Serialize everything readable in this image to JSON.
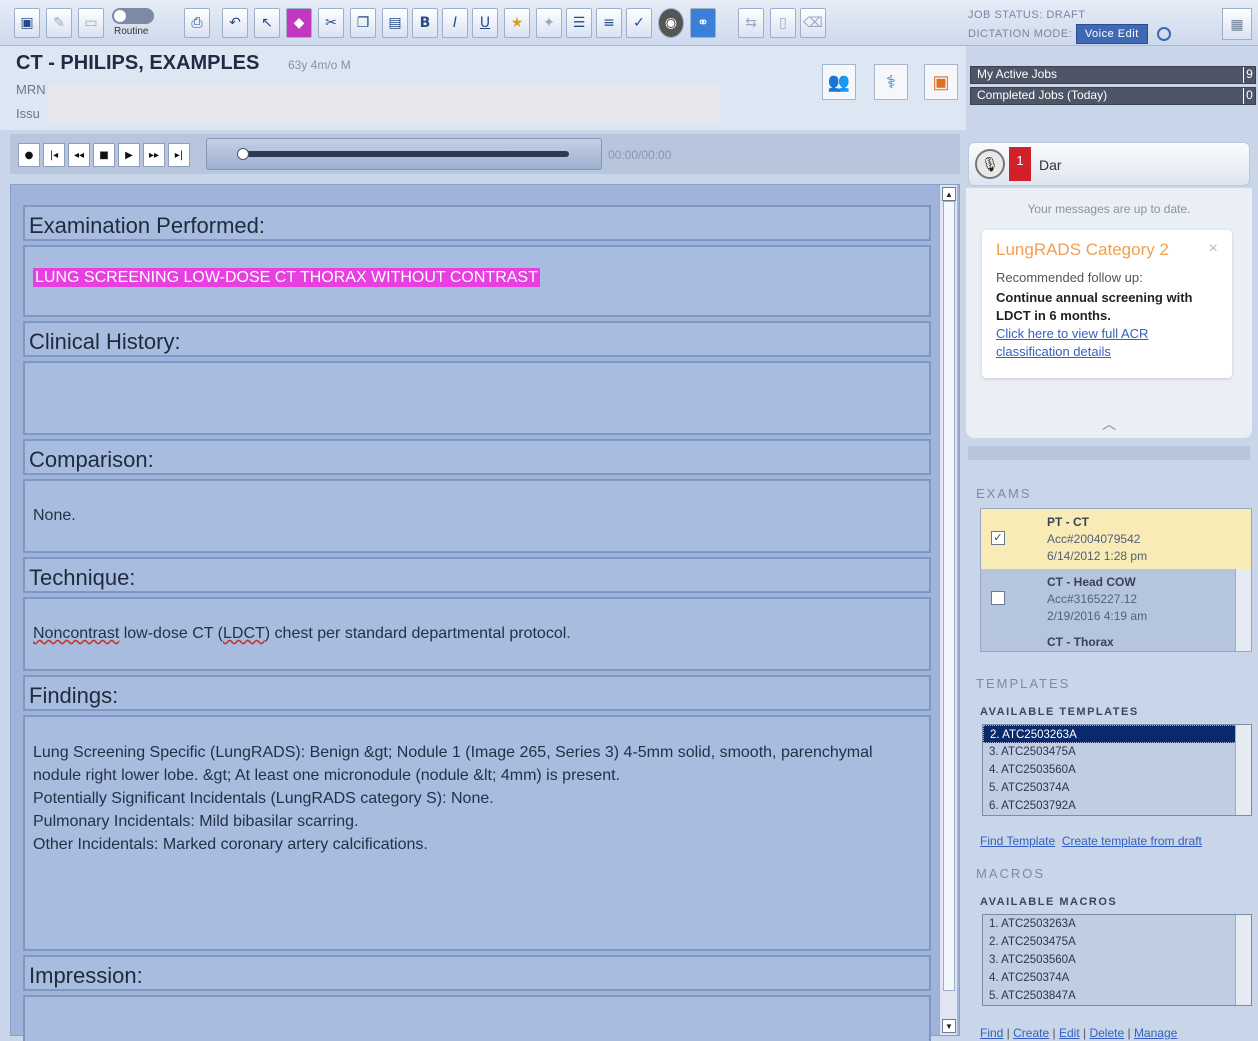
{
  "toolbar": {
    "routine_label": "Routine",
    "job_status": "JOB STATUS: DRAFT",
    "dictation_mode_label": "DICTATION MODE:",
    "voice_edit": "Voice Edit",
    "buttons": [
      {
        "icon": "save-icon",
        "glyph": "💾"
      },
      {
        "icon": "sign-icon",
        "glyph": "✎"
      },
      {
        "icon": "preview-icon",
        "glyph": "▭"
      },
      {
        "icon": "print-icon",
        "glyph": "🖶"
      },
      {
        "icon": "undo-icon",
        "glyph": "↶"
      },
      {
        "icon": "cursor-icon",
        "glyph": "↖"
      },
      {
        "icon": "highlight-icon",
        "glyph": "◆"
      },
      {
        "icon": "cut-icon",
        "glyph": "✂"
      },
      {
        "icon": "copy-icon",
        "glyph": "❐"
      },
      {
        "icon": "paste-icon",
        "glyph": "📋"
      },
      {
        "icon": "bold-icon",
        "glyph": "B"
      },
      {
        "icon": "italic-icon",
        "glyph": "I"
      },
      {
        "icon": "underline-icon",
        "glyph": "U"
      },
      {
        "icon": "star-icon",
        "glyph": "★"
      },
      {
        "icon": "pin-icon",
        "glyph": "✦"
      },
      {
        "icon": "bullet-list-icon",
        "glyph": "☰"
      },
      {
        "icon": "numbered-list-icon",
        "glyph": "≡"
      },
      {
        "icon": "spellcheck-icon",
        "glyph": "✓"
      },
      {
        "icon": "camera-icon",
        "glyph": "◉"
      },
      {
        "icon": "link-icon",
        "glyph": "🔗"
      },
      {
        "icon": "merge-icon",
        "glyph": "⇆"
      },
      {
        "icon": "document-icon",
        "glyph": "▯"
      },
      {
        "icon": "trash-icon",
        "glyph": "🗑"
      }
    ]
  },
  "patient": {
    "name": "CT - PHILIPS, EXAMPLES",
    "age": "63y 4m/o M",
    "mrn_label": "MRN",
    "issuer_label": "Issu"
  },
  "jobs": [
    {
      "label": "My Active Jobs",
      "count": "9"
    },
    {
      "label": "Completed Jobs (Today)",
      "count": "0"
    }
  ],
  "player": {
    "time": "00:00/00:00",
    "progress": 0.0
  },
  "report": {
    "sections": [
      {
        "title": "Examination Performed:",
        "body": "LUNG SCREENING LOW-DOSE CT THORAX WITHOUT CONTRAST"
      },
      {
        "title": "Clinical History:",
        "body": ""
      },
      {
        "title": "Comparison:",
        "body": "None."
      },
      {
        "title": "Technique:",
        "body_parts": [
          "Noncontrast",
          " low-dose CT (",
          "LDCT",
          ") chest per standard departmental protocol."
        ]
      },
      {
        "title": "Findings:",
        "lines": [
          "Lung Screening Specific (LungRADS): Benign &gt; Nodule 1 (Image 265, Series 3) 4-5mm solid, smooth, parenchymal",
          "nodule right lower lobe. &gt; At least one micronodule (nodule &lt; 4mm) is present.",
          "Potentially Significant Incidentals (LungRADS category S): None.",
          "Pulmonary Incidentals: Mild bibasilar scarring.",
          "Other Incidentals: Marked coronary artery calcifications."
        ]
      },
      {
        "title": "Impression:",
        "body": ""
      }
    ]
  },
  "messages": {
    "count": "1",
    "tab_label": "Dar",
    "status": "Your messages are up to date.",
    "card": {
      "title": "LungRADS Category 2",
      "recommended": "Recommended follow up:",
      "action": "Continue annual screening with LDCT in 6 months.",
      "link": "Click here to view full ACR classification details"
    }
  },
  "exams": {
    "title": "EXAMS",
    "rows": [
      {
        "name": "PT - CT",
        "acc": "Acc#2004079542",
        "date": "6/14/2012 1:28 pm",
        "checked": true
      },
      {
        "name": "CT - Head COW",
        "acc": "Acc#3165227.12",
        "date": "2/19/2016 4:19 am",
        "checked": false
      },
      {
        "name": "CT - Thorax",
        "acc": "",
        "date": "",
        "checked": false
      }
    ]
  },
  "templates": {
    "title": "TEMPLATES",
    "subtitle": "AVAILABLE TEMPLATES",
    "items": [
      "2. ATC2503263A",
      "3. ATC2503475A",
      "4. ATC2503560A",
      "5. ATC250374A",
      "6. ATC2503792A"
    ],
    "find_link": "Find Template",
    "create_link": "Create template from draft"
  },
  "macros": {
    "title": "MACROS",
    "subtitle": "AVAILABLE MACROS",
    "items": [
      "1. ATC2503263A",
      "2. ATC2503475A",
      "3. ATC2503560A",
      "4. ATC250374A",
      "5. ATC2503847A"
    ],
    "actions": [
      "Find",
      "Create",
      "Edit",
      "Delete",
      "Manage"
    ]
  }
}
